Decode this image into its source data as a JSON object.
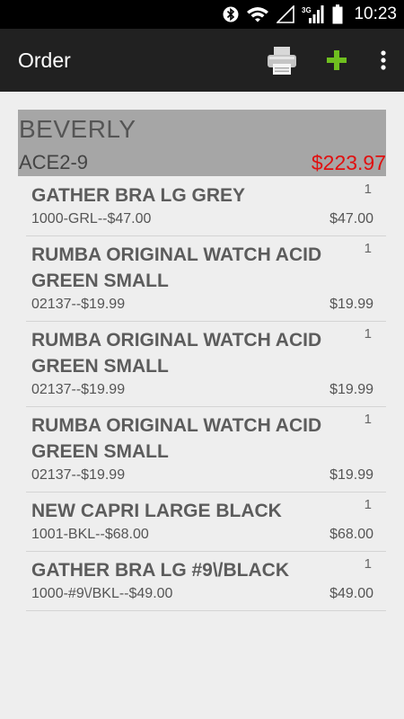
{
  "status_bar": {
    "time": "10:23",
    "network_type": "3G"
  },
  "action_bar": {
    "title": "Order",
    "icons": [
      "printer-icon",
      "plus-icon",
      "overflow-menu-icon"
    ],
    "add_color": "#6fbf1f"
  },
  "customer": {
    "name": "BEVERLY",
    "code": "ACE2-9",
    "total": "$223.97",
    "total_color": "#e01010"
  },
  "items": [
    {
      "name": "GATHER BRA LG GREY",
      "qty": "1",
      "sku_price": "1000-GRL--$47.00",
      "price": "$47.00"
    },
    {
      "name": "RUMBA ORIGINAL WATCH ACID GREEN SMALL",
      "qty": "1",
      "sku_price": "02137--$19.99",
      "price": "$19.99"
    },
    {
      "name": "RUMBA ORIGINAL WATCH ACID GREEN SMALL",
      "qty": "1",
      "sku_price": "02137--$19.99",
      "price": "$19.99"
    },
    {
      "name": "RUMBA ORIGINAL WATCH ACID GREEN SMALL",
      "qty": "1",
      "sku_price": "02137--$19.99",
      "price": "$19.99"
    },
    {
      "name": "NEW CAPRI LARGE BLACK",
      "qty": "1",
      "sku_price": "1001-BKL--$68.00",
      "price": "$68.00"
    },
    {
      "name": "GATHER BRA LG #9\\/BLACK",
      "qty": "1",
      "sku_price": "1000-#9\\/BKL--$49.00",
      "price": "$49.00"
    }
  ]
}
